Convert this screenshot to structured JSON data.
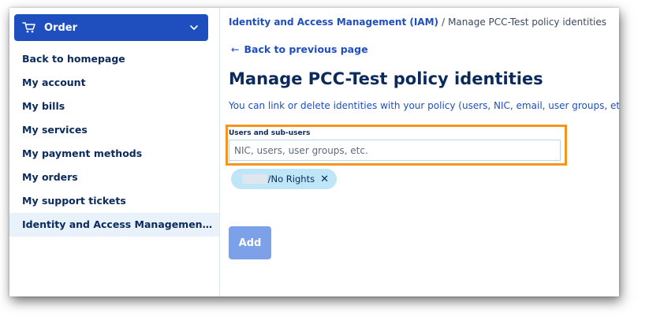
{
  "sidebar": {
    "order_button": {
      "label": "Order",
      "icon": "cart-icon",
      "chevron": "chevron-down-icon"
    },
    "items": [
      {
        "label": "Back to homepage"
      },
      {
        "label": "My account"
      },
      {
        "label": "My bills"
      },
      {
        "label": "My services"
      },
      {
        "label": "My payment methods"
      },
      {
        "label": "My orders"
      },
      {
        "label": "My support tickets"
      },
      {
        "label": "Identity and Access Management (IAM)...",
        "active": true
      }
    ]
  },
  "main": {
    "breadcrumb": {
      "link": "Identity and Access Management (IAM)",
      "separator": "/",
      "current": "Manage PCC-Test policy identities"
    },
    "back_link": {
      "arrow": "←",
      "label": "Back to previous page"
    },
    "title": "Manage PCC-Test policy identities",
    "subtitle": "You can link or delete identities with your policy (users, NIC, email, user groups, etc.)",
    "field": {
      "label": "Users and sub-users",
      "placeholder": "NIC, users, user groups, etc.",
      "value": ""
    },
    "tag": {
      "text": "/No Rights",
      "close": "✕"
    },
    "add_button": "Add"
  },
  "colors": {
    "primary": "#1f4fbf",
    "navy": "#0a2a5c",
    "highlight": "#f7941d",
    "tag_bg": "#bfe6f7",
    "add_disabled": "#7da1e9",
    "active_bg": "#e9f2fb"
  }
}
